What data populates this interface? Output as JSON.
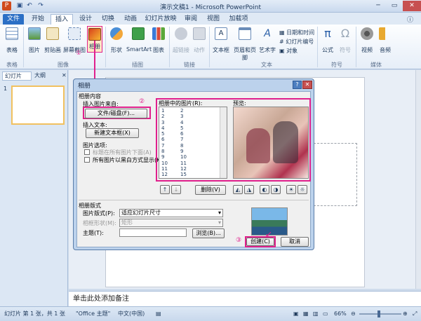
{
  "window": {
    "title": "演示文稿1 - Microsoft PowerPoint"
  },
  "qat": {
    "save_icon": "save-icon",
    "undo_icon": "undo-icon",
    "redo_icon": "redo-icon"
  },
  "tabs": [
    "文件",
    "开始",
    "插入",
    "设计",
    "切换",
    "动画",
    "幻灯片放映",
    "审阅",
    "视图",
    "加载项"
  ],
  "ribbon": {
    "groups": {
      "table": "表格",
      "image": "图像",
      "illustration": "插图",
      "link": "链接",
      "text": "文本",
      "symbol": "符号",
      "media": "媒体"
    },
    "buttons": {
      "table": "表格",
      "picture": "图片",
      "clipart": "剪贴画",
      "screenshot": "屏幕截图",
      "album": "相册",
      "shapes": "形状",
      "smartart": "SmartArt",
      "chart": "图表",
      "hyperlink": "超链接",
      "action": "动作",
      "textbox": "文本框",
      "headerfooter": "页眉和页脚",
      "wordart": "艺术字",
      "datetime": "日期和时间",
      "slidenum": "幻灯片编号",
      "object": "对象",
      "equation": "公式",
      "symbol": "符号",
      "video": "视频",
      "audio": "音频"
    },
    "marker1": "①"
  },
  "sidepanel": {
    "tab_slides": "幻灯片",
    "tab_outline": "大纲",
    "slide_number": "1"
  },
  "notes": {
    "placeholder": "单击此处添加备注"
  },
  "status": {
    "slide": "幻灯片 第 1 张，共 1 张",
    "theme": "\"Office 主题\"",
    "lang": "中文(中国)",
    "zoom": "66%"
  },
  "dialog": {
    "title": "相册",
    "help": "?",
    "section_content": "相册内容",
    "insert_from": "插入图片来自:",
    "marker2": "②",
    "file_disk_btn": "文件/磁盘(F)...",
    "insert_text": "插入文本:",
    "new_textbox_btn": "新建文本框(X)",
    "pic_options": "图片选项:",
    "caption_below": "标题在所有图片下面(A)",
    "all_bw": "所有图片以黑白方式显示(K)",
    "pics_in_album": "相册中的图片(R):",
    "list_col1": [
      "1",
      "2",
      "3",
      "4",
      "5",
      "6",
      "7",
      "8",
      "9",
      "10",
      "11",
      "12"
    ],
    "list_col2": [
      "2",
      "3",
      "4",
      "5",
      "6",
      "7",
      "8",
      "9",
      "10",
      "11",
      "12",
      "15"
    ],
    "preview": "预览:",
    "up_arrow": "↑",
    "down_arrow": "↓",
    "delete_btn": "删除(V)",
    "section_layout": "相册版式",
    "pic_layout_label": "图片版式(P):",
    "pic_layout_value": "适应幻灯片尺寸",
    "frame_label": "相框形状(M):",
    "frame_value": "矩形",
    "theme_label": "主题(T):",
    "browse_btn": "浏览(B)...",
    "marker3": "③",
    "create_btn": "创建(C)",
    "cancel_btn": "取消"
  },
  "colors": {
    "accent_pink": "#e0208c",
    "file_tab": "#2b6fc5"
  }
}
